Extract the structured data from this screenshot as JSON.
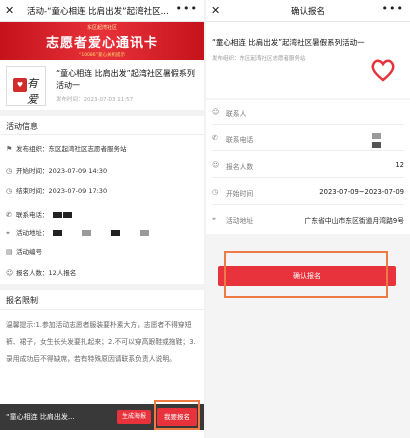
{
  "left": {
    "topbar": {
      "title": "活动-“童心相连 比肩出发”起湾社区...",
      "more": "•••"
    },
    "banner": {
      "sub": "东区起湾社区",
      "main": "志愿者爱心通讯卡",
      "foot": "“10086”爱心关机提示"
    },
    "logo_text": "有爱",
    "activity": {
      "title": "“童心相连 比肩出发”起湾社区暑假系列活动一",
      "date": "发布时间：2023-07-03 11:57"
    },
    "info": {
      "heading": "活动信息",
      "organizer": "发布组织：东区起湾社区志愿者服务站",
      "start": "开始时间：2023-07-09 14:30",
      "end": "结束时间：2023-07-09 17:30",
      "phone_label": "联系电话：",
      "address_label": "活动地址：",
      "code_label": "活动编号",
      "count": "报名人数：12人报名"
    },
    "limit_heading": "报名限制",
    "notice": "温馨提示:1.参加活动志愿者服装要朴素大方，志愿者不得穿短裤、裙子，女生长头发要扎起来；2.不可以穿高跟鞋或拖鞋；3.录用成功后不得缺席，若有特殊原因请联系负责人说明。",
    "bottombar": {
      "title": "“童心相连 比肩出发...",
      "poster_btn": "生成海报",
      "signup_btn": "我要报名"
    }
  },
  "right": {
    "topbar": {
      "title": "确认报名",
      "more": "•••"
    },
    "card": {
      "title": "“童心相连 比肩出发”起湾社区暑假系列活动一",
      "org": "发布组织：东区起湾社区志愿者服务站"
    },
    "form": {
      "contact_label": "联系人",
      "phone_label": "联系电话",
      "count_label": "报名人数",
      "count_value": "12",
      "start_label": "开始时间",
      "start_value": "2023-07-09~2023-07-09",
      "address_label": "活动地址",
      "address_value": "广东省中山市东区街道月湾路9号"
    },
    "confirm_btn": "确认报名"
  },
  "colors": {
    "accent": "#e8333c",
    "highlight": "#ee7b46"
  },
  "icons": [
    "close-icon",
    "more-icon",
    "flag-icon",
    "clock-icon",
    "phone-icon",
    "location-icon",
    "code-icon",
    "user-icon",
    "heart-icon"
  ]
}
